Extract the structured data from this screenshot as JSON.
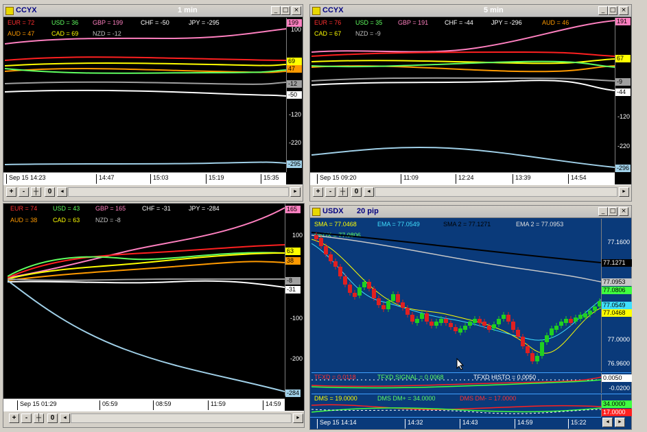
{
  "windows": [
    {
      "id": "w1",
      "name": "CCYX",
      "timeframe": "1 min",
      "legend": [
        {
          "text": "EUR = 72",
          "color": "#ff3030"
        },
        {
          "text": "USD = 36",
          "color": "#60ff60"
        },
        {
          "text": "GBP = 199",
          "color": "#ff80c0"
        },
        {
          "text": "CHF = -50",
          "color": "#ffffff"
        },
        {
          "text": "JPY = -295",
          "color": "#ffffff"
        },
        {
          "text": "AUD = 47",
          "color": "#ff9a00"
        },
        {
          "text": "CAD = 69",
          "color": "#ffff00"
        },
        {
          "text": "NZD = -12",
          "color": "#c0c0c0"
        }
      ],
      "scale_labels": [
        "100",
        "-120",
        "-220"
      ],
      "tags": [
        {
          "text": "199",
          "color": "#ff80c0"
        },
        {
          "text": "69",
          "color": "#ffff00"
        },
        {
          "text": "47",
          "color": "#ff9a00"
        },
        {
          "text": "-12",
          "color": "#a0a0a0"
        },
        {
          "text": "-50",
          "color": "#ffffff"
        },
        {
          "text": "-295",
          "color": "#a0d0e8"
        }
      ],
      "time_labels": [
        "Sep 15 14:23",
        "14:47",
        "15:03",
        "15:19",
        "15:35"
      ],
      "nav": {
        "plus": "+",
        "minus": "-",
        "zero": "0",
        "left": "◄",
        "right": "►"
      }
    },
    {
      "id": "w2",
      "name": "CCYX",
      "timeframe": "5 min",
      "legend": [
        {
          "text": "EUR = 76",
          "color": "#ff3030"
        },
        {
          "text": "USD = 35",
          "color": "#60ff60"
        },
        {
          "text": "GBP = 191",
          "color": "#ff80c0"
        },
        {
          "text": "CHF = -44",
          "color": "#ffffff"
        },
        {
          "text": "JPY = -296",
          "color": "#ffffff"
        },
        {
          "text": "AUD = 46",
          "color": "#ff9a00"
        },
        {
          "text": "CAD = 67",
          "color": "#ffff00"
        },
        {
          "text": "NZD = -9",
          "color": "#c0c0c0"
        }
      ],
      "scale_labels": [
        "-120",
        "-220"
      ],
      "tags": [
        {
          "text": "191",
          "color": "#ff80c0"
        },
        {
          "text": "67",
          "color": "#ffff00"
        },
        {
          "text": "-9",
          "color": "#a0a0a0"
        },
        {
          "text": "-44",
          "color": "#ffffff"
        },
        {
          "text": "-296",
          "color": "#a0d0e8"
        }
      ],
      "time_labels": [
        "Sep 15 09:20",
        "11:09",
        "12:24",
        "13:39",
        "14:54"
      ],
      "nav": {
        "plus": "+",
        "minus": "-",
        "zero": "0",
        "left": "◄",
        "right": "►"
      }
    },
    {
      "id": "w3",
      "name": "",
      "timeframe": "",
      "legend": [
        {
          "text": "EUR = 74",
          "color": "#ff3030"
        },
        {
          "text": "USD = 43",
          "color": "#60ff60"
        },
        {
          "text": "GBP = 165",
          "color": "#ff80c0"
        },
        {
          "text": "CHF = -31",
          "color": "#ffffff"
        },
        {
          "text": "JPY = -284",
          "color": "#ffffff"
        },
        {
          "text": "AUD = 38",
          "color": "#ff9a00"
        },
        {
          "text": "CAD = 63",
          "color": "#ffff00"
        },
        {
          "text": "NZD = -8",
          "color": "#c0c0c0"
        }
      ],
      "scale_labels": [
        "100",
        "-100",
        "-200"
      ],
      "tags": [
        {
          "text": "165",
          "color": "#ff80c0"
        },
        {
          "text": "63",
          "color": "#ffff00"
        },
        {
          "text": "38",
          "color": "#ff9a00"
        },
        {
          "text": "-8",
          "color": "#a0a0a0"
        },
        {
          "text": "-31",
          "color": "#ffffff"
        },
        {
          "text": "-284",
          "color": "#a0d0e8"
        }
      ],
      "time_labels": [
        "Sep 15 01:29",
        "05:59",
        "08:59",
        "11:59",
        "14:59"
      ],
      "nav": {
        "plus": "+",
        "minus": "-",
        "zero": "0",
        "left": "◄",
        "right": "►"
      }
    },
    {
      "id": "w4",
      "name": "USDX",
      "timeframe": "20 pip",
      "legend": [
        {
          "text": "SMA = 77.0468",
          "color": "#ffff00"
        },
        {
          "text": "EMA = 77.0549",
          "color": "#40e0ff"
        },
        {
          "text": "SMA 2 = 77.1271",
          "color": "#000000"
        },
        {
          "text": "EMA 2 = 77.0953",
          "color": "#e0e0e0"
        },
        {
          "text": "USDX = 77.0806",
          "color": "#60ff60"
        }
      ],
      "scale_labels": [
        "77.1600",
        "77.0000",
        "76.9600"
      ],
      "tags": [
        {
          "text": "77.1271",
          "color": "#000000",
          "fg": "#ffffff"
        },
        {
          "text": "77.0953",
          "color": "#c8c8c8"
        },
        {
          "text": "77.0806",
          "color": "#40ff40"
        },
        {
          "text": "77.0549",
          "color": "#40e0ff"
        },
        {
          "text": "77.0468",
          "color": "#ffff00"
        }
      ],
      "tfxd": {
        "legend": [
          {
            "text": "TFXD = 0.0118",
            "color": "#ff3030"
          },
          {
            "text": "TFXD SIGNAL = 0.0068",
            "color": "#60ff60"
          },
          {
            "text": "TFXD HISTO = 0.0050",
            "color": "#ffffff"
          }
        ],
        "scale_labels": [
          "-0.0200"
        ],
        "tags": [
          {
            "text": "0.0050",
            "color": "#ffffff"
          }
        ]
      },
      "dms": {
        "legend": [
          {
            "text": "DMS = 19.0000",
            "color": "#ffff00"
          },
          {
            "text": "DMS DM+ = 34.0000",
            "color": "#60ff60"
          },
          {
            "text": "DMS DM- = 17.0000",
            "color": "#ff3030"
          }
        ],
        "tags": [
          {
            "text": "34.0000",
            "color": "#40ff40"
          },
          {
            "text": "17.0000",
            "color": "#ff2020",
            "fg": "#ffffff"
          }
        ]
      },
      "time_labels": [
        "Sep 15 14:14",
        "14:32",
        "14:43",
        "14:59",
        "15:22"
      ],
      "nav": {
        "left": "◄",
        "right": "►"
      }
    }
  ],
  "buttons": {
    "minimize": "_",
    "maximize": "□",
    "close": "×"
  },
  "colors": {
    "bg": "#000000",
    "usdx_bg": "#0a3a7a",
    "title_text": "#000080"
  }
}
